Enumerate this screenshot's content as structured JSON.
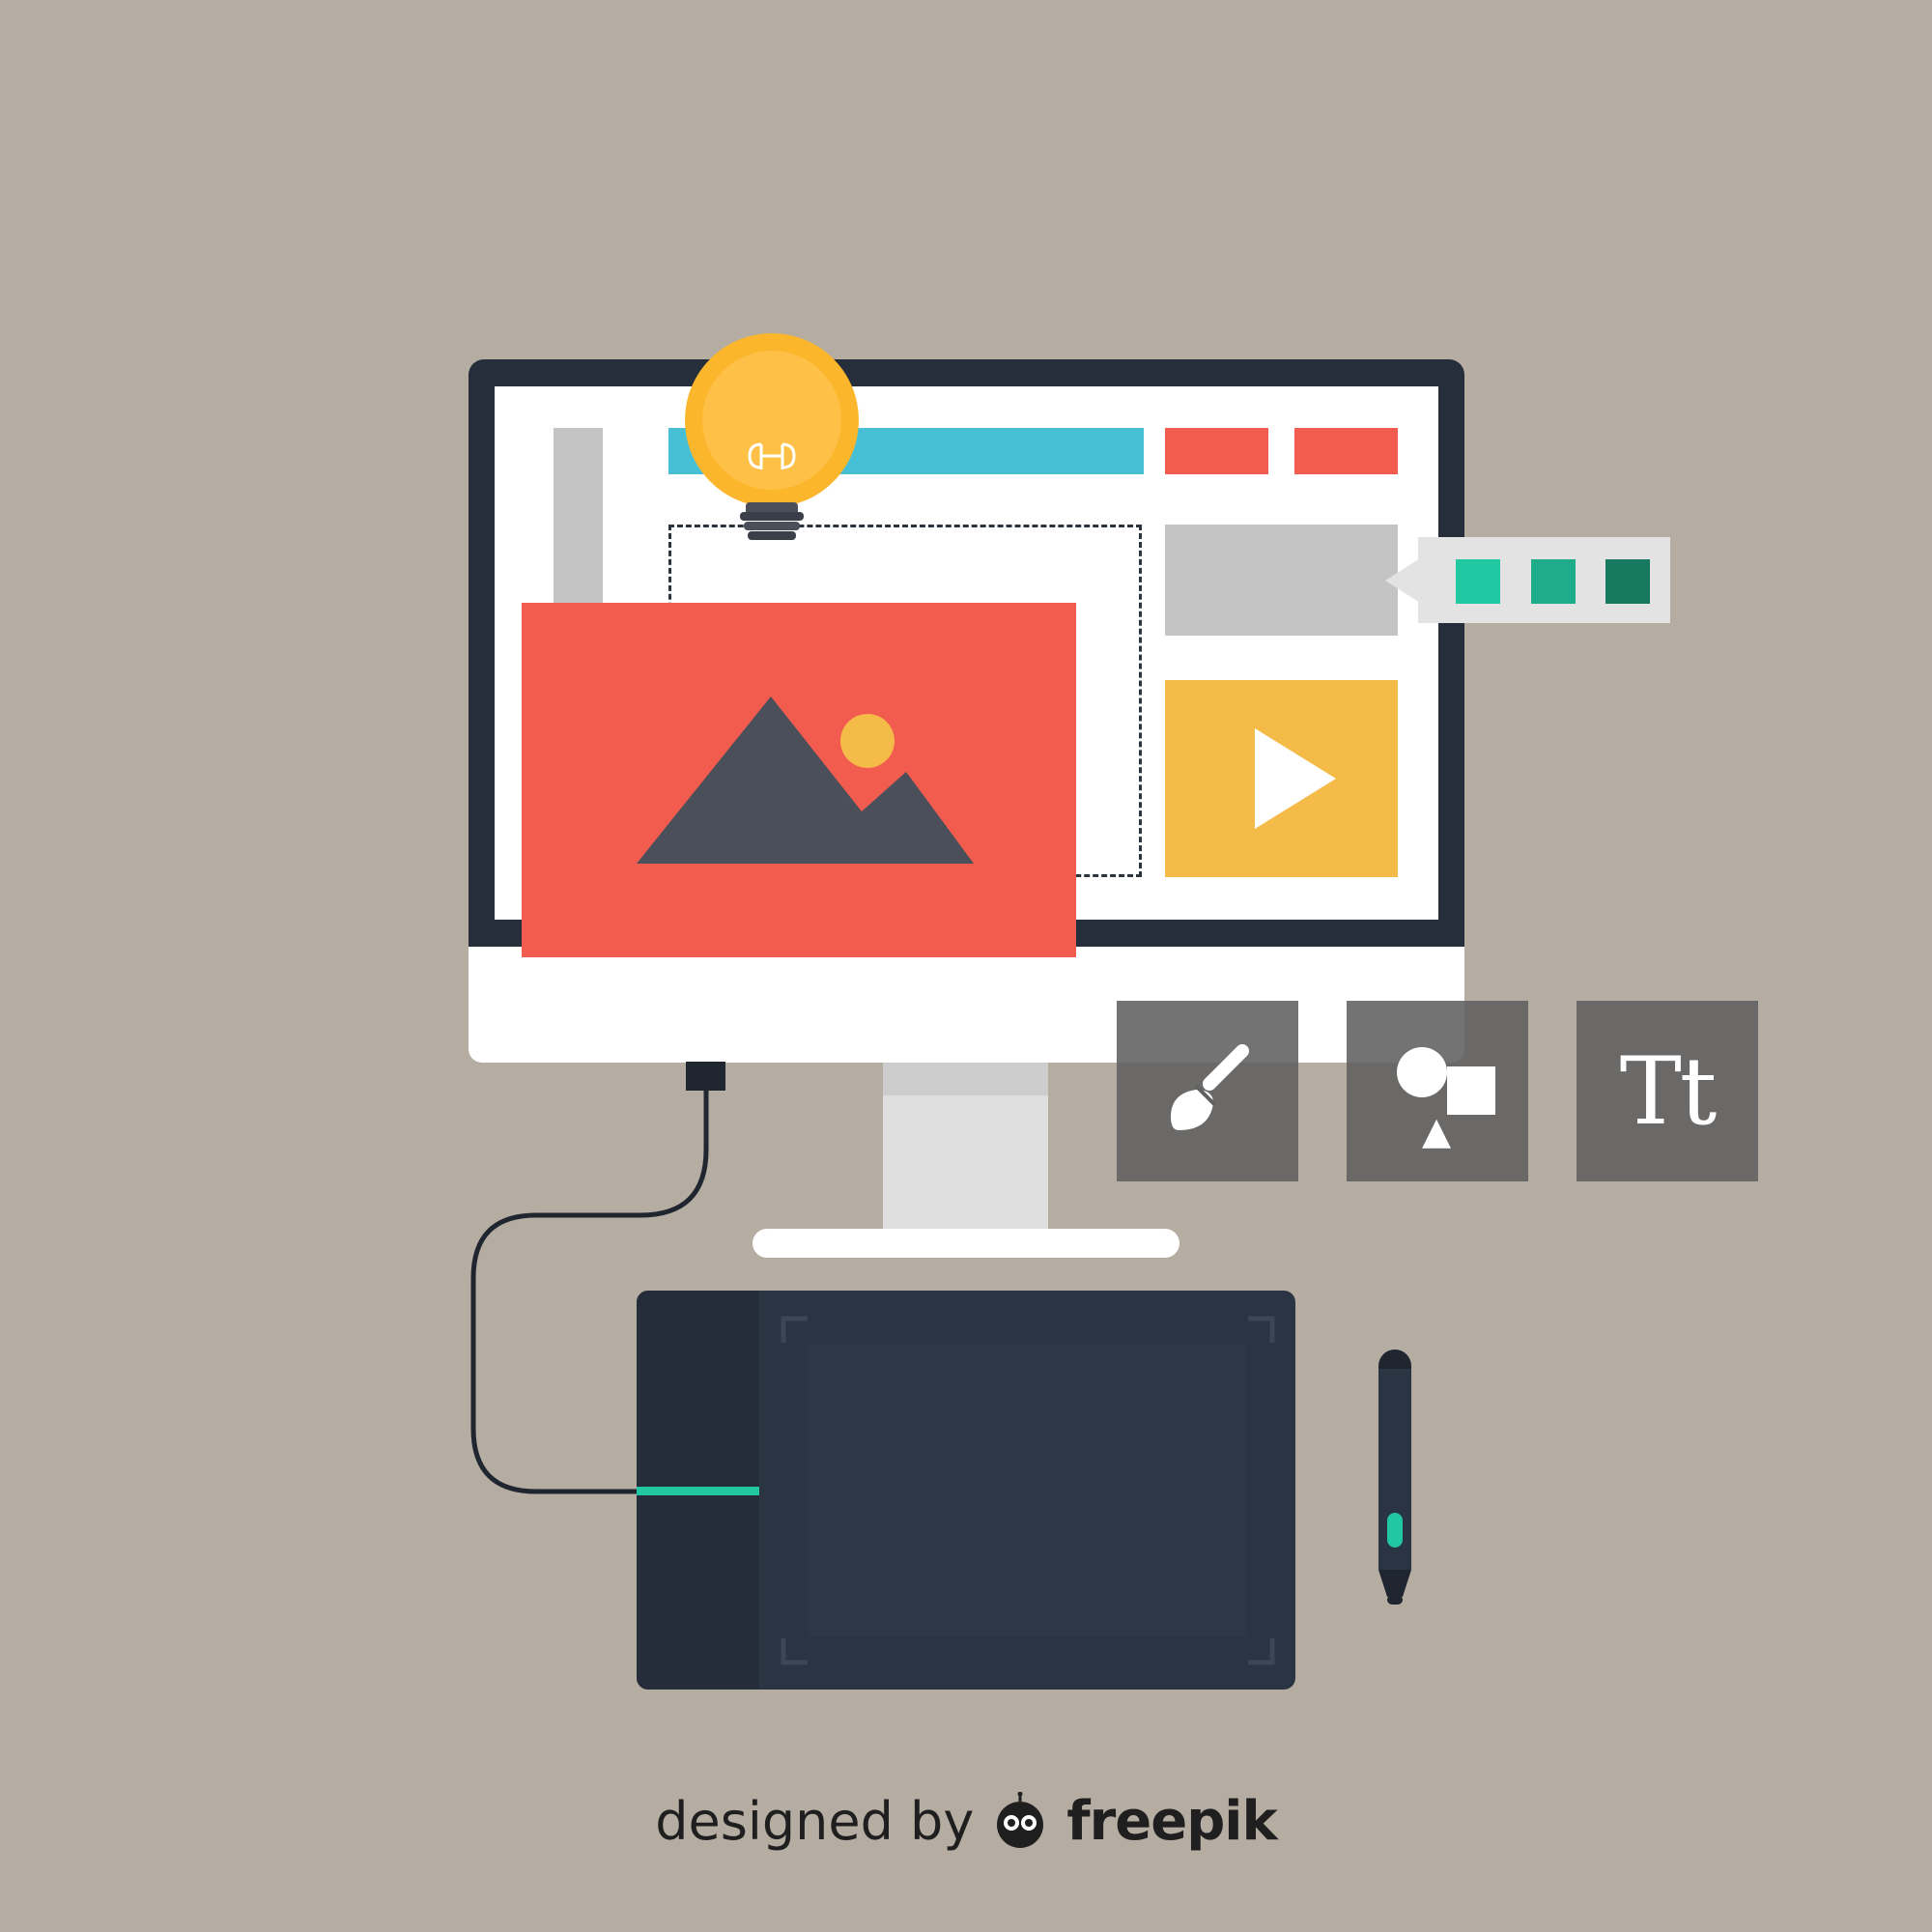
{
  "colors": {
    "background": "#b5aca2",
    "bezel": "#252e3a",
    "screen": "#ffffff",
    "accent_blue": "#47c0d6",
    "accent_red": "#f25c4e",
    "accent_yellow": "#f4bb49",
    "bulb": "#fbb62b",
    "mountain": "#4a4f5a",
    "tablet": "#2b3442",
    "indicator": "#20c7a0"
  },
  "swatches": [
    "#21c9a3",
    "#1eac8b",
    "#187961"
  ],
  "tools": [
    {
      "name": "brush",
      "icon": "paintbrush-icon"
    },
    {
      "name": "shapes",
      "icon": "shapes-icon"
    },
    {
      "name": "text",
      "icon": "text-tool-icon",
      "label": "Tt"
    }
  ],
  "credit": {
    "prefix": "designed by",
    "brand": "freepik"
  }
}
